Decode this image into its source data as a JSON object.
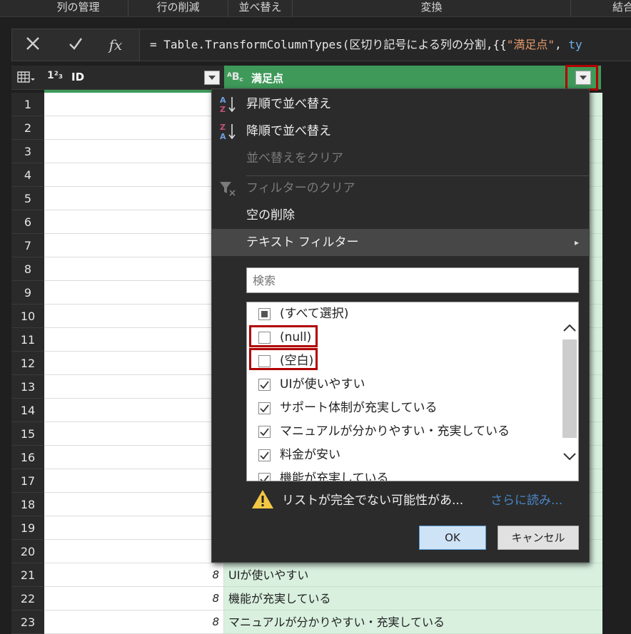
{
  "ribbon": {
    "groups": [
      "列の管理",
      "行の削減",
      "並べ替え",
      "変換",
      "結合"
    ]
  },
  "formula_bar": {
    "cancel_icon": "close-icon",
    "commit_icon": "check-icon",
    "fx_label": "fx",
    "formula_prefix": "= Table.TransformColumnTypes(区切り記号による列の分割,{{",
    "formula_string": "\"満足点\"",
    "formula_sep": ", ",
    "formula_kw": "ty"
  },
  "grid": {
    "columns": [
      {
        "type_label": "1²₃",
        "name": "ID"
      },
      {
        "type_label": "ᴬB꜀",
        "name": "満足点"
      }
    ],
    "row_numbers": [
      "1",
      "2",
      "3",
      "4",
      "5",
      "6",
      "7",
      "8",
      "9",
      "10",
      "11",
      "12",
      "13",
      "14",
      "15",
      "16",
      "17",
      "18",
      "19",
      "20",
      "21",
      "22",
      "23"
    ],
    "visible_rows": [
      {
        "n": "21",
        "id": "8",
        "value": "UIが使いやすい"
      },
      {
        "n": "22",
        "id": "8",
        "value": "機能が充実している"
      },
      {
        "n": "23",
        "id": "8",
        "value": "マニュアルが分かりやすい・充実している"
      }
    ]
  },
  "menu": {
    "items": [
      {
        "label": "昇順で並べ替え",
        "icon": "sort-ascending-icon",
        "disabled": false
      },
      {
        "label": "降順で並べ替え",
        "icon": "sort-descending-icon",
        "disabled": false
      },
      {
        "label": "並べ替えをクリア",
        "icon": "",
        "disabled": true
      },
      {
        "label": "フィルターのクリア",
        "icon": "clear-filter-icon",
        "disabled": true
      },
      {
        "label": "空の削除",
        "icon": "",
        "disabled": false
      },
      {
        "label": "テキスト フィルター",
        "icon": "",
        "disabled": false,
        "submenu": true
      }
    ],
    "submenu_arrow": "▸",
    "search_placeholder": "検索",
    "filter_list": [
      {
        "label": "(すべて選択)",
        "state": "indeterminate"
      },
      {
        "label": "(null)",
        "state": "unchecked"
      },
      {
        "label": "(空白)",
        "state": "unchecked"
      },
      {
        "label": "UIが使いやすい",
        "state": "checked"
      },
      {
        "label": "サポート体制が充実している",
        "state": "checked"
      },
      {
        "label": "マニュアルが分かりやすい・充実している",
        "state": "checked"
      },
      {
        "label": "料金が安い",
        "state": "checked"
      },
      {
        "label": "機能が充実している",
        "state": "checked"
      }
    ],
    "warning_text": "リストが完全でない可能性があ...",
    "load_more_link": "さらに読み...",
    "ok_label": "OK",
    "cancel_label": "キャンセル"
  }
}
